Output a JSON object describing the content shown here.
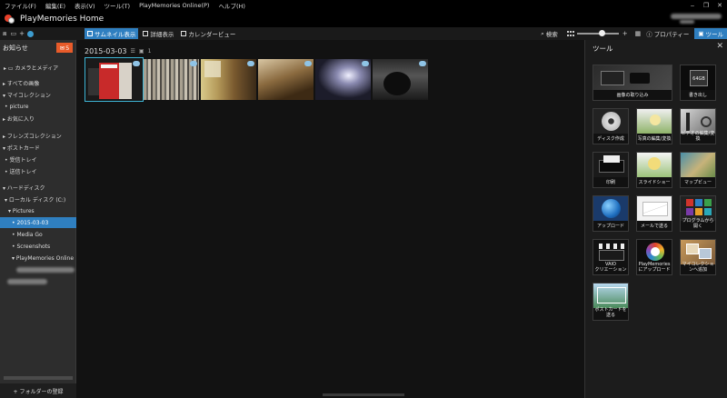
{
  "menu": [
    {
      "key": "file",
      "label": "ファイル(F)"
    },
    {
      "key": "edit",
      "label": "編集(E)"
    },
    {
      "key": "view",
      "label": "表示(V)"
    },
    {
      "key": "tools",
      "label": "ツール(T)"
    },
    {
      "key": "online",
      "label": "PlayMemories Online(P)"
    },
    {
      "key": "help",
      "label": "ヘルプ(H)"
    }
  ],
  "window_controls": {
    "minimize": "‒",
    "restore": "❐",
    "close": "✕"
  },
  "app": {
    "title": "PlayMemories Home"
  },
  "toolbar": {
    "views": [
      {
        "key": "thumbnail",
        "label": "サムネイル表示",
        "active": true
      },
      {
        "key": "detail",
        "label": "詳細表示",
        "active": false
      },
      {
        "key": "calendar",
        "label": "カレンダービュー",
        "active": false
      }
    ],
    "search_label": "検索",
    "slider_plus": "+",
    "properties_label": "プロパティー",
    "tools_label": "ツール"
  },
  "sidebar": {
    "notice_label": "お知らせ",
    "notice_count": "5",
    "items": [
      {
        "key": "camera-media",
        "label": "▸ ▭  カメラとメディア",
        "selected": false
      },
      {
        "key": "all-images",
        "label": "▸ すべての画像",
        "selected": false
      },
      {
        "key": "my-collection",
        "label": "▾ マイコレクション",
        "selected": false
      },
      {
        "key": "picture",
        "label": "• picture",
        "selected": false
      },
      {
        "key": "favorites",
        "label": "▸ お気に入り",
        "selected": false
      },
      {
        "key": "friends-collection",
        "label": "▸ フレンズコレクション",
        "selected": false
      },
      {
        "key": "postcard",
        "label": "▾ ポストカード",
        "selected": false
      },
      {
        "key": "inbox",
        "label": "• 受信トレイ",
        "selected": false
      },
      {
        "key": "outbox",
        "label": "• 送信トレイ",
        "selected": false
      },
      {
        "key": "hard-disk",
        "label": "▾ ハードディスク",
        "selected": false
      },
      {
        "key": "local-disk",
        "label": "▾ ローカル ディスク (C:)",
        "selected": false
      },
      {
        "key": "pictures",
        "label": "▾ Pictures",
        "selected": false
      },
      {
        "key": "date-folder",
        "label": "• 2015-03-03",
        "selected": true
      },
      {
        "key": "media-go",
        "label": "• Media Go",
        "selected": false
      },
      {
        "key": "screenshots",
        "label": "• Screenshots",
        "selected": false
      },
      {
        "key": "playmemories-online",
        "label": "▾ PlayMemories Online",
        "selected": false
      }
    ],
    "add_folder_label": "+ フォルダーの登録"
  },
  "main": {
    "date_label": "2015-03-03",
    "date_icon_a": "☰",
    "date_icon_b": "▣",
    "date_count": "1"
  },
  "panel": {
    "title": "ツール",
    "close": "✕",
    "tools": [
      {
        "key": "import",
        "label": "画像の取り込み"
      },
      {
        "key": "write-back",
        "label": "書き出し"
      },
      {
        "key": "disc-create",
        "label": "ディスク作成"
      },
      {
        "key": "photo-edit",
        "label": "写真の編集/変換"
      },
      {
        "key": "video-edit",
        "label": "ビデオの編集/変換"
      },
      {
        "key": "print",
        "label": "印刷"
      },
      {
        "key": "slideshow",
        "label": "スライドショー"
      },
      {
        "key": "map-view",
        "label": "マップビュー"
      },
      {
        "key": "upload",
        "label": "アップロード"
      },
      {
        "key": "mail",
        "label": "メールで送る"
      },
      {
        "key": "open-with",
        "label": "プログラムから\n開く"
      },
      {
        "key": "vaio-creations",
        "label": "VAIO\nクリエーション"
      },
      {
        "key": "pm-online-upload",
        "label": "PlayMemories\nにアップロード"
      },
      {
        "key": "add-collection",
        "label": "マイコレクショ\nンへ追加"
      },
      {
        "key": "send-postcard",
        "label": "ポストカードを\n送る"
      }
    ],
    "capacity_text": "64GB"
  }
}
